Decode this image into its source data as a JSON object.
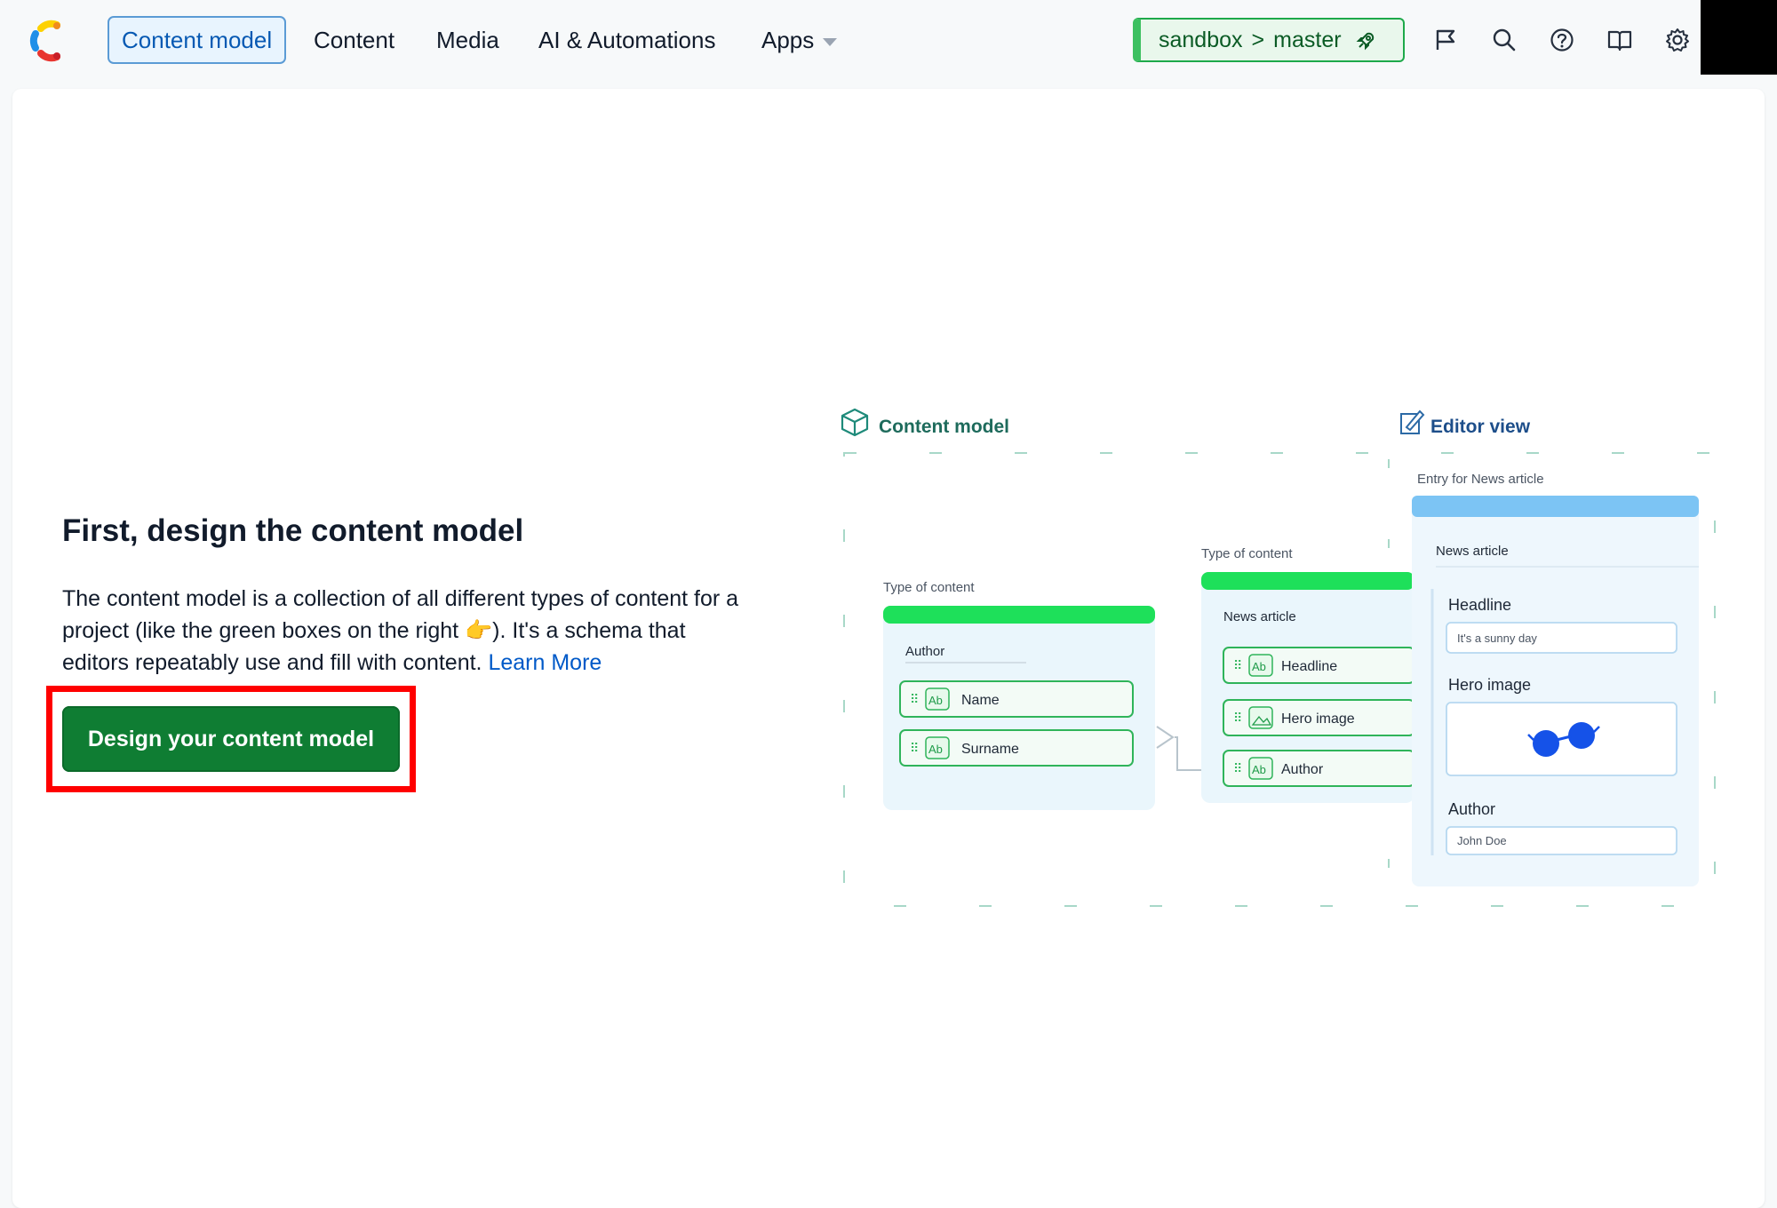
{
  "nav": {
    "items": [
      {
        "label": "Content model",
        "active": true
      },
      {
        "label": "Content",
        "active": false
      },
      {
        "label": "Media",
        "active": false
      },
      {
        "label": "AI & Automations",
        "active": false
      },
      {
        "label": "Apps",
        "active": false
      }
    ],
    "environment": {
      "space": "sandbox",
      "separator": ">",
      "branch": "master"
    },
    "icons": [
      "flag-icon",
      "search-icon",
      "help-icon",
      "book-icon",
      "gear-icon"
    ]
  },
  "main": {
    "title": "First, design the content model",
    "description": "The content model is a collection of all different types of content for a project (like the green boxes on the right 👉). It's a schema that editors repeatably use and fill with content.",
    "learn_more": "Learn More",
    "cta_label": "Design your content model"
  },
  "illustration": {
    "content_model_label": "Content model",
    "editor_view_label": "Editor view",
    "type_of_content_label": "Type of content",
    "author_card": {
      "title": "Author",
      "fields": [
        "Name",
        "Surname"
      ]
    },
    "news_card": {
      "title": "News article",
      "fields": [
        "Headline",
        "Hero image",
        "Author"
      ]
    },
    "field_badge": "Ab",
    "entry": {
      "caption": "Entry for News article",
      "title": "News article",
      "headline_label": "Headline",
      "headline_value": "It's a sunny day",
      "hero_label": "Hero image",
      "author_label": "Author",
      "author_value": "John Doe"
    }
  },
  "colors": {
    "accent_green": "#0f7d33",
    "bright_green": "#1ee05a",
    "nav_active_bg": "#e8f4fe",
    "link_blue": "#0059c8",
    "highlight_red": "#ff0000"
  }
}
